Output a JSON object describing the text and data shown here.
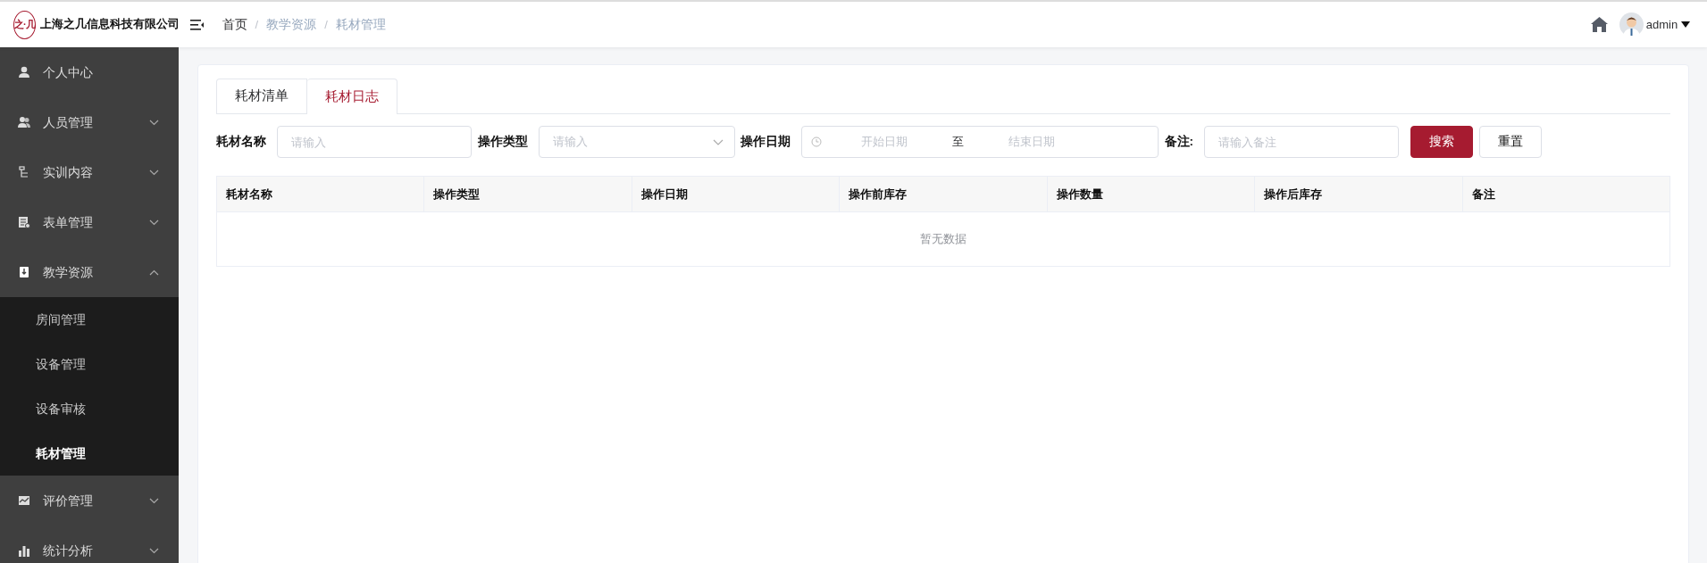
{
  "header": {
    "company": "上海之几信息科技有限公司",
    "logo_text": "之·几",
    "breadcrumb": [
      "首页",
      "教学资源",
      "耗材管理"
    ],
    "breadcrumb_separator": "/",
    "user": "admin"
  },
  "sidebar": {
    "items": [
      {
        "label": "个人中心"
      },
      {
        "label": "人员管理",
        "expanded": false
      },
      {
        "label": "实训内容",
        "expanded": false
      },
      {
        "label": "表单管理",
        "expanded": false
      },
      {
        "label": "教学资源",
        "expanded": true,
        "children": [
          {
            "label": "房间管理",
            "selected": false
          },
          {
            "label": "设备管理",
            "selected": false
          },
          {
            "label": "设备审核",
            "selected": false
          },
          {
            "label": "耗材管理",
            "selected": true
          }
        ]
      },
      {
        "label": "评价管理",
        "expanded": false
      },
      {
        "label": "统计分析",
        "expanded": false
      }
    ]
  },
  "tabs": [
    {
      "label": "耗材清单",
      "selected": false
    },
    {
      "label": "耗材日志",
      "selected": true
    }
  ],
  "filters": [
    {
      "kind": "text",
      "label": "耗材名称",
      "placeholder": "请输入"
    },
    {
      "kind": "select",
      "label": "操作类型",
      "placeholder": "请输入"
    },
    {
      "kind": "daterange",
      "label": "操作日期",
      "start_placeholder": "开始日期",
      "separator": "至",
      "end_placeholder": "结束日期"
    },
    {
      "kind": "text",
      "label": "备注:",
      "placeholder": "请输入备注"
    }
  ],
  "buttons": [
    {
      "label": "搜索",
      "kind": "primary"
    },
    {
      "label": "重置",
      "kind": "default"
    }
  ],
  "table": {
    "columns": [
      "耗材名称",
      "操作类型",
      "操作日期",
      "操作前库存",
      "操作数量",
      "操作后库存",
      "备注"
    ],
    "empty_text": "暂无数据"
  }
}
